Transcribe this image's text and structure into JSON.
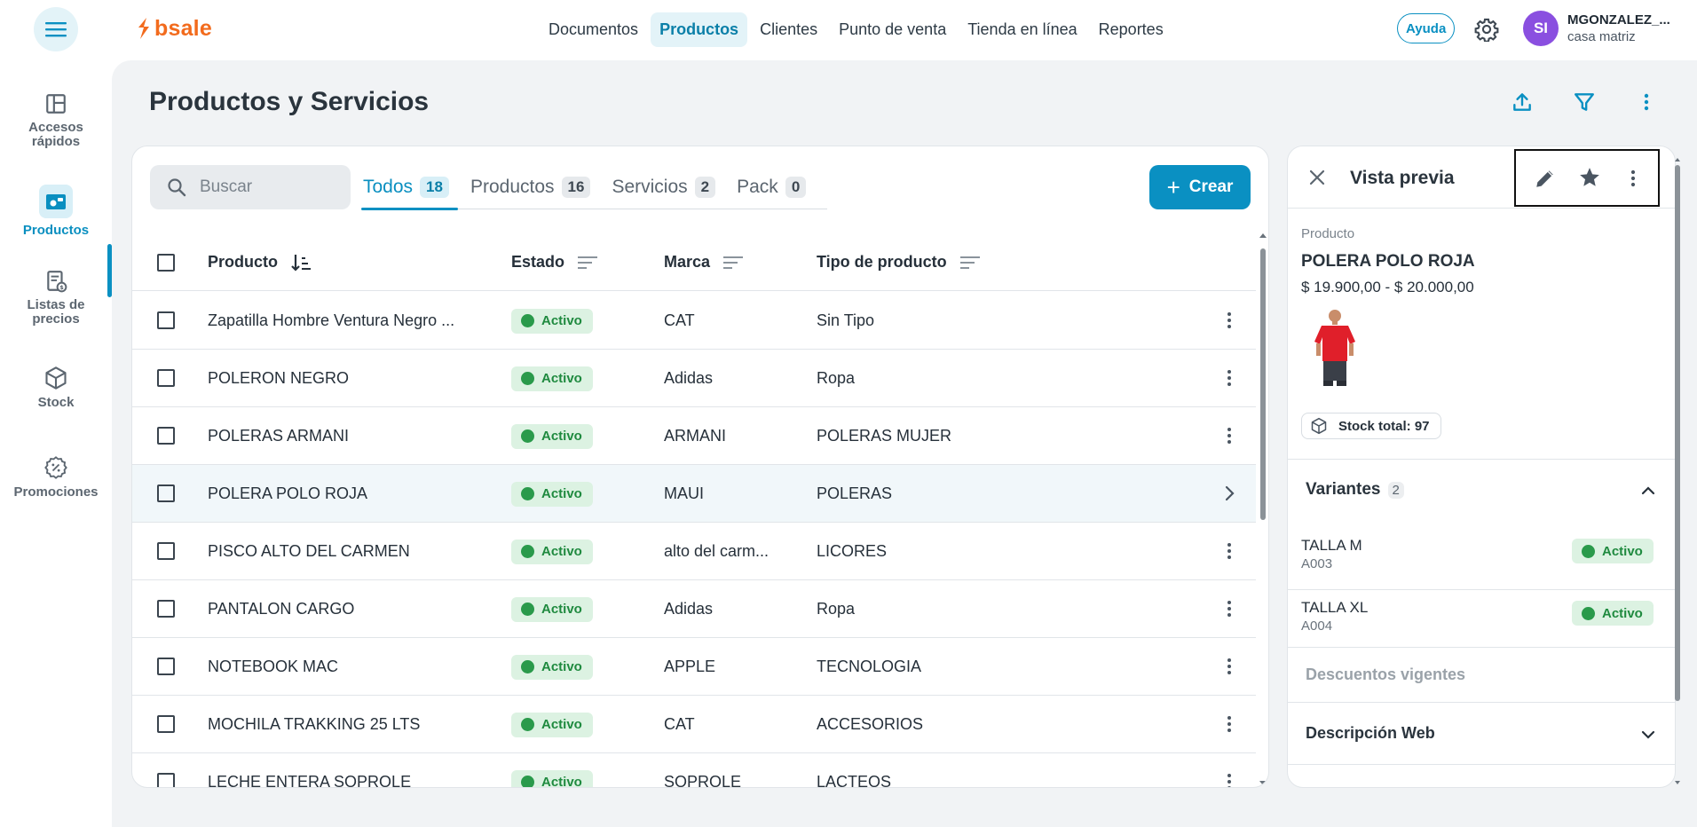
{
  "app": {
    "logo_text": "bsale",
    "brand_color": "#f26b1d",
    "accent_color": "#0a90c2"
  },
  "nav": [
    {
      "label": "Documentos",
      "active": false
    },
    {
      "label": "Productos",
      "active": true
    },
    {
      "label": "Clientes",
      "active": false
    },
    {
      "label": "Punto de venta",
      "active": false
    },
    {
      "label": "Tienda en línea",
      "active": false
    },
    {
      "label": "Reportes",
      "active": false
    }
  ],
  "header": {
    "help_label": "Ayuda",
    "avatar_initials": "SI",
    "user_name": "MGONZALEZ_...",
    "user_branch": "casa matriz"
  },
  "sidebar": [
    {
      "label1": "Accesos",
      "label2": "rápidos",
      "icon": "quick-access-icon"
    },
    {
      "label1": "Productos",
      "label2": "",
      "icon": "products-icon",
      "active": true
    },
    {
      "label1": "Listas de",
      "label2": "precios",
      "icon": "price-list-icon"
    },
    {
      "label1": "Stock",
      "label2": "",
      "icon": "box-icon"
    },
    {
      "label1": "Promociones",
      "label2": "",
      "icon": "promo-icon"
    }
  ],
  "page": {
    "title": "Productos y Servicios"
  },
  "search": {
    "placeholder": "Buscar",
    "value": ""
  },
  "tabs": [
    {
      "label": "Todos",
      "count": "18",
      "active": true
    },
    {
      "label": "Productos",
      "count": "16"
    },
    {
      "label": "Servicios",
      "count": "2"
    },
    {
      "label": "Pack",
      "count": "0"
    }
  ],
  "create_label": "Crear",
  "columns": {
    "producto": "Producto",
    "estado": "Estado",
    "marca": "Marca",
    "tipo": "Tipo de producto"
  },
  "rows": [
    {
      "producto": "Zapatilla Hombre Ventura Negro ...",
      "estado": "Activo",
      "marca": "CAT",
      "tipo": "Sin Tipo"
    },
    {
      "producto": "POLERON NEGRO",
      "estado": "Activo",
      "marca": "Adidas",
      "tipo": "Ropa"
    },
    {
      "producto": "POLERAS ARMANI",
      "estado": "Activo",
      "marca": "ARMANI",
      "tipo": "POLERAS MUJER"
    },
    {
      "producto": "POLERA POLO ROJA",
      "estado": "Activo",
      "marca": "MAUI",
      "tipo": "POLERAS",
      "selected": true
    },
    {
      "producto": "PISCO ALTO DEL CARMEN",
      "estado": "Activo",
      "marca": "alto del carm...",
      "tipo": "LICORES"
    },
    {
      "producto": "PANTALON CARGO",
      "estado": "Activo",
      "marca": "Adidas",
      "tipo": "Ropa"
    },
    {
      "producto": "NOTEBOOK MAC",
      "estado": "Activo",
      "marca": "APPLE",
      "tipo": "TECNOLOGIA"
    },
    {
      "producto": "MOCHILA TRAKKING 25 LTS",
      "estado": "Activo",
      "marca": "CAT",
      "tipo": "ACCESORIOS"
    },
    {
      "producto": "LECHE ENTERA SOPROLE",
      "estado": "Activo",
      "marca": "SOPROLE",
      "tipo": "LACTEOS"
    }
  ],
  "preview": {
    "title": "Vista previa",
    "label": "Producto",
    "name": "POLERA POLO ROJA",
    "price": "$ 19.900,00 - $ 20.000,00",
    "stock": "Stock total: 97",
    "variants_title": "Variantes",
    "variants_count": "2",
    "variants": [
      {
        "name": "TALLA M",
        "sku": "A003",
        "estado": "Activo"
      },
      {
        "name": "TALLA XL",
        "sku": "A004",
        "estado": "Activo"
      }
    ],
    "discounts": "Descuentos vigentes",
    "web_description": "Descripción Web"
  }
}
